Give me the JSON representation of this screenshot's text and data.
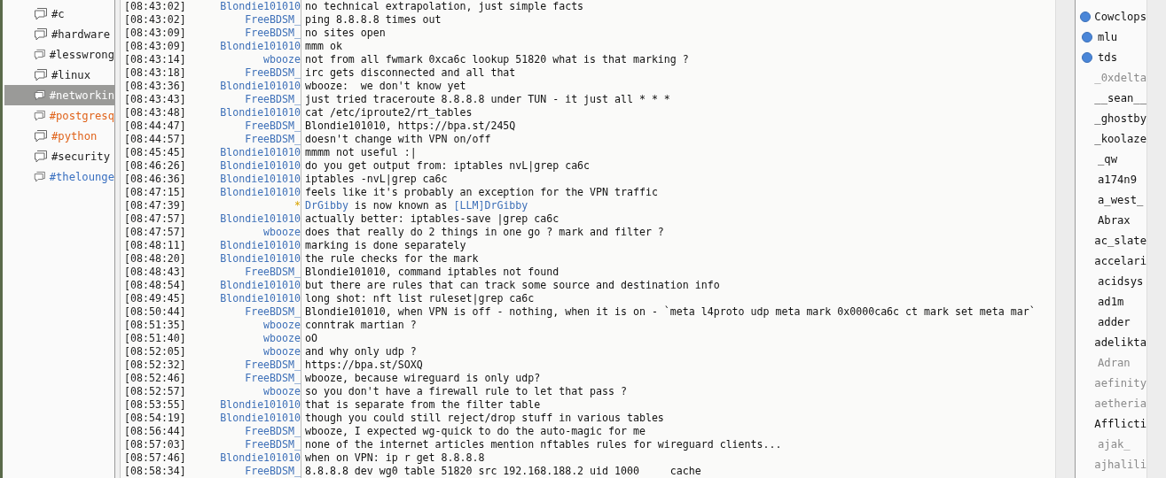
{
  "channels": [
    {
      "name": "#c",
      "selected": false,
      "color": "#222222"
    },
    {
      "name": "#hardware",
      "selected": false,
      "color": "#222222"
    },
    {
      "name": "#lesswrong",
      "selected": false,
      "color": "#222222"
    },
    {
      "name": "#linux",
      "selected": false,
      "color": "#222222"
    },
    {
      "name": "#networkin",
      "selected": true,
      "color": "#ffffff"
    },
    {
      "name": "#postgresq",
      "selected": false,
      "color": "#e0641c"
    },
    {
      "name": "#python",
      "selected": false,
      "color": "#e0641c"
    },
    {
      "name": "#security",
      "selected": false,
      "color": "#222222"
    },
    {
      "name": "#thelounge",
      "selected": false,
      "color": "#3a70c0"
    }
  ],
  "messages": [
    {
      "kind": "message",
      "time": "[08:43:02]",
      "nick": "Blondie101010",
      "text": "no technical extrapolation, just simple facts"
    },
    {
      "kind": "message",
      "time": "[08:43:02]",
      "nick": "FreeBDSM_",
      "text": "ping 8.8.8.8 times out"
    },
    {
      "kind": "message",
      "time": "[08:43:09]",
      "nick": "FreeBDSM_",
      "text": "no sites open"
    },
    {
      "kind": "message",
      "time": "[08:43:09]",
      "nick": "Blondie101010",
      "text": "mmm ok"
    },
    {
      "kind": "message",
      "time": "[08:43:14]",
      "nick": "wbooze",
      "text": "not from all fwmark 0xca6c lookup 51820 what is that marking ?"
    },
    {
      "kind": "message",
      "time": "[08:43:18]",
      "nick": "FreeBDSM_",
      "text": "irc gets disconnected and all that"
    },
    {
      "kind": "message",
      "time": "[08:43:36]",
      "nick": "Blondie101010",
      "text": "wbooze:  we don't know yet"
    },
    {
      "kind": "message",
      "time": "[08:43:43]",
      "nick": "FreeBDSM_",
      "text": "just tried traceroute 8.8.8.8 under TUN - it just all * * *"
    },
    {
      "kind": "message",
      "time": "[08:43:48]",
      "nick": "Blondie101010",
      "text": "cat /etc/iproute2/rt_tables"
    },
    {
      "kind": "message",
      "time": "[08:44:47]",
      "nick": "FreeBDSM_",
      "text": "Blondie101010, https://bpa.st/245Q"
    },
    {
      "kind": "message",
      "time": "[08:44:57]",
      "nick": "FreeBDSM_",
      "text": "doesn't change with VPN on/off"
    },
    {
      "kind": "message",
      "time": "[08:45:45]",
      "nick": "Blondie101010",
      "text": "mmmm not useful :|"
    },
    {
      "kind": "message",
      "time": "[08:46:26]",
      "nick": "Blondie101010",
      "text": "do you get output from: iptables nvL|grep ca6c"
    },
    {
      "kind": "message",
      "time": "[08:46:36]",
      "nick": "Blondie101010",
      "text": "iptables -nvL|grep ca6c"
    },
    {
      "kind": "message",
      "time": "[08:47:15]",
      "nick": "Blondie101010",
      "text": "feels like it's probably an exception for the VPN traffic"
    },
    {
      "kind": "nick_change",
      "time": "[08:47:39]",
      "nick": "*",
      "old_nick": "DrGibby",
      "text": "is now known as",
      "new_nick": "[LLM]DrGibby"
    },
    {
      "kind": "message",
      "time": "[08:47:57]",
      "nick": "Blondie101010",
      "text": "actually better: iptables-save |grep ca6c"
    },
    {
      "kind": "message",
      "time": "[08:47:57]",
      "nick": "wbooze",
      "text": "does that really do 2 things in one go ? mark and filter ?"
    },
    {
      "kind": "message",
      "time": "[08:48:11]",
      "nick": "Blondie101010",
      "text": "marking is done separately"
    },
    {
      "kind": "message",
      "time": "[08:48:20]",
      "nick": "Blondie101010",
      "text": "the rule checks for the mark"
    },
    {
      "kind": "message",
      "time": "[08:48:43]",
      "nick": "FreeBDSM_",
      "text": "Blondie101010, command iptables not found"
    },
    {
      "kind": "message",
      "time": "[08:48:54]",
      "nick": "Blondie101010",
      "text": "but there are rules that can track some source and destination info"
    },
    {
      "kind": "message",
      "time": "[08:49:45]",
      "nick": "Blondie101010",
      "text": "long shot: nft list ruleset|grep ca6c"
    },
    {
      "kind": "message",
      "time": "[08:50:44]",
      "nick": "FreeBDSM_",
      "text": "Blondie101010, when VPN is off - nothing, when it is on - `meta l4proto udp meta mark 0x0000ca6c ct mark set meta mar`"
    },
    {
      "kind": "message",
      "time": "[08:51:35]",
      "nick": "wbooze",
      "text": "conntrak martian ?"
    },
    {
      "kind": "message",
      "time": "[08:51:40]",
      "nick": "wbooze",
      "text": "oO"
    },
    {
      "kind": "message",
      "time": "[08:52:05]",
      "nick": "wbooze",
      "text": "and why only udp ?"
    },
    {
      "kind": "message",
      "time": "[08:52:32]",
      "nick": "FreeBDSM_",
      "text": "https://bpa.st/SOXQ"
    },
    {
      "kind": "message",
      "time": "[08:52:46]",
      "nick": "FreeBDSM_",
      "text": "wbooze, because wireguard is only udp?"
    },
    {
      "kind": "message",
      "time": "[08:52:57]",
      "nick": "wbooze",
      "text": "so you don't have a firewall rule to let that pass ?"
    },
    {
      "kind": "message",
      "time": "[08:53:55]",
      "nick": "Blondie101010",
      "text": "that is separate from the filter table"
    },
    {
      "kind": "message",
      "time": "[08:54:19]",
      "nick": "Blondie101010",
      "text": "though you could still reject/drop stuff in various tables"
    },
    {
      "kind": "message",
      "time": "[08:56:44]",
      "nick": "FreeBDSM_",
      "text": "wbooze, I expected wg-quick to do the auto-magic for me"
    },
    {
      "kind": "message",
      "time": "[08:57:03]",
      "nick": "FreeBDSM_",
      "text": "none of the internet articles mention nftables rules for wireguard clients..."
    },
    {
      "kind": "message",
      "time": "[08:57:46]",
      "nick": "Blondie101010",
      "text": "when on VPN: ip r get 8.8.8.8"
    },
    {
      "kind": "message",
      "time": "[08:58:34]",
      "nick": "FreeBDSM_",
      "text": "8.8.8.8 dev wg0 table 51820 src 192.168.188.2 uid 1000     cache"
    }
  ],
  "users": [
    {
      "nick": "Cowclops",
      "kind": "op",
      "away": false
    },
    {
      "nick": "mlu",
      "kind": "op",
      "away": false
    },
    {
      "nick": "tds",
      "kind": "op",
      "away": false
    },
    {
      "nick": "_0xdelta",
      "kind": "user",
      "away": true
    },
    {
      "nick": "__sean__",
      "kind": "user",
      "away": false
    },
    {
      "nick": "_ghostby",
      "kind": "user",
      "away": false
    },
    {
      "nick": "_koolaze",
      "kind": "user",
      "away": false
    },
    {
      "nick": "_qw",
      "kind": "user",
      "away": false
    },
    {
      "nick": "a174n9",
      "kind": "user",
      "away": false
    },
    {
      "nick": "a_west_",
      "kind": "user",
      "away": false
    },
    {
      "nick": "Abrax",
      "kind": "user",
      "away": false
    },
    {
      "nick": "ac_slate",
      "kind": "user",
      "away": false
    },
    {
      "nick": "accelari",
      "kind": "user",
      "away": false
    },
    {
      "nick": "acidsys",
      "kind": "user",
      "away": false
    },
    {
      "nick": "ad1m",
      "kind": "user",
      "away": false
    },
    {
      "nick": "adder",
      "kind": "user",
      "away": false
    },
    {
      "nick": "adelikta",
      "kind": "user",
      "away": false
    },
    {
      "nick": "Adran",
      "kind": "user",
      "away": true
    },
    {
      "nick": "aefinity",
      "kind": "user",
      "away": true
    },
    {
      "nick": "aetheria",
      "kind": "user",
      "away": true
    },
    {
      "nick": "Afflicti",
      "kind": "user",
      "away": false
    },
    {
      "nick": "ajak_",
      "kind": "user",
      "away": true
    },
    {
      "nick": "ajhalili",
      "kind": "user",
      "away": true
    }
  ]
}
